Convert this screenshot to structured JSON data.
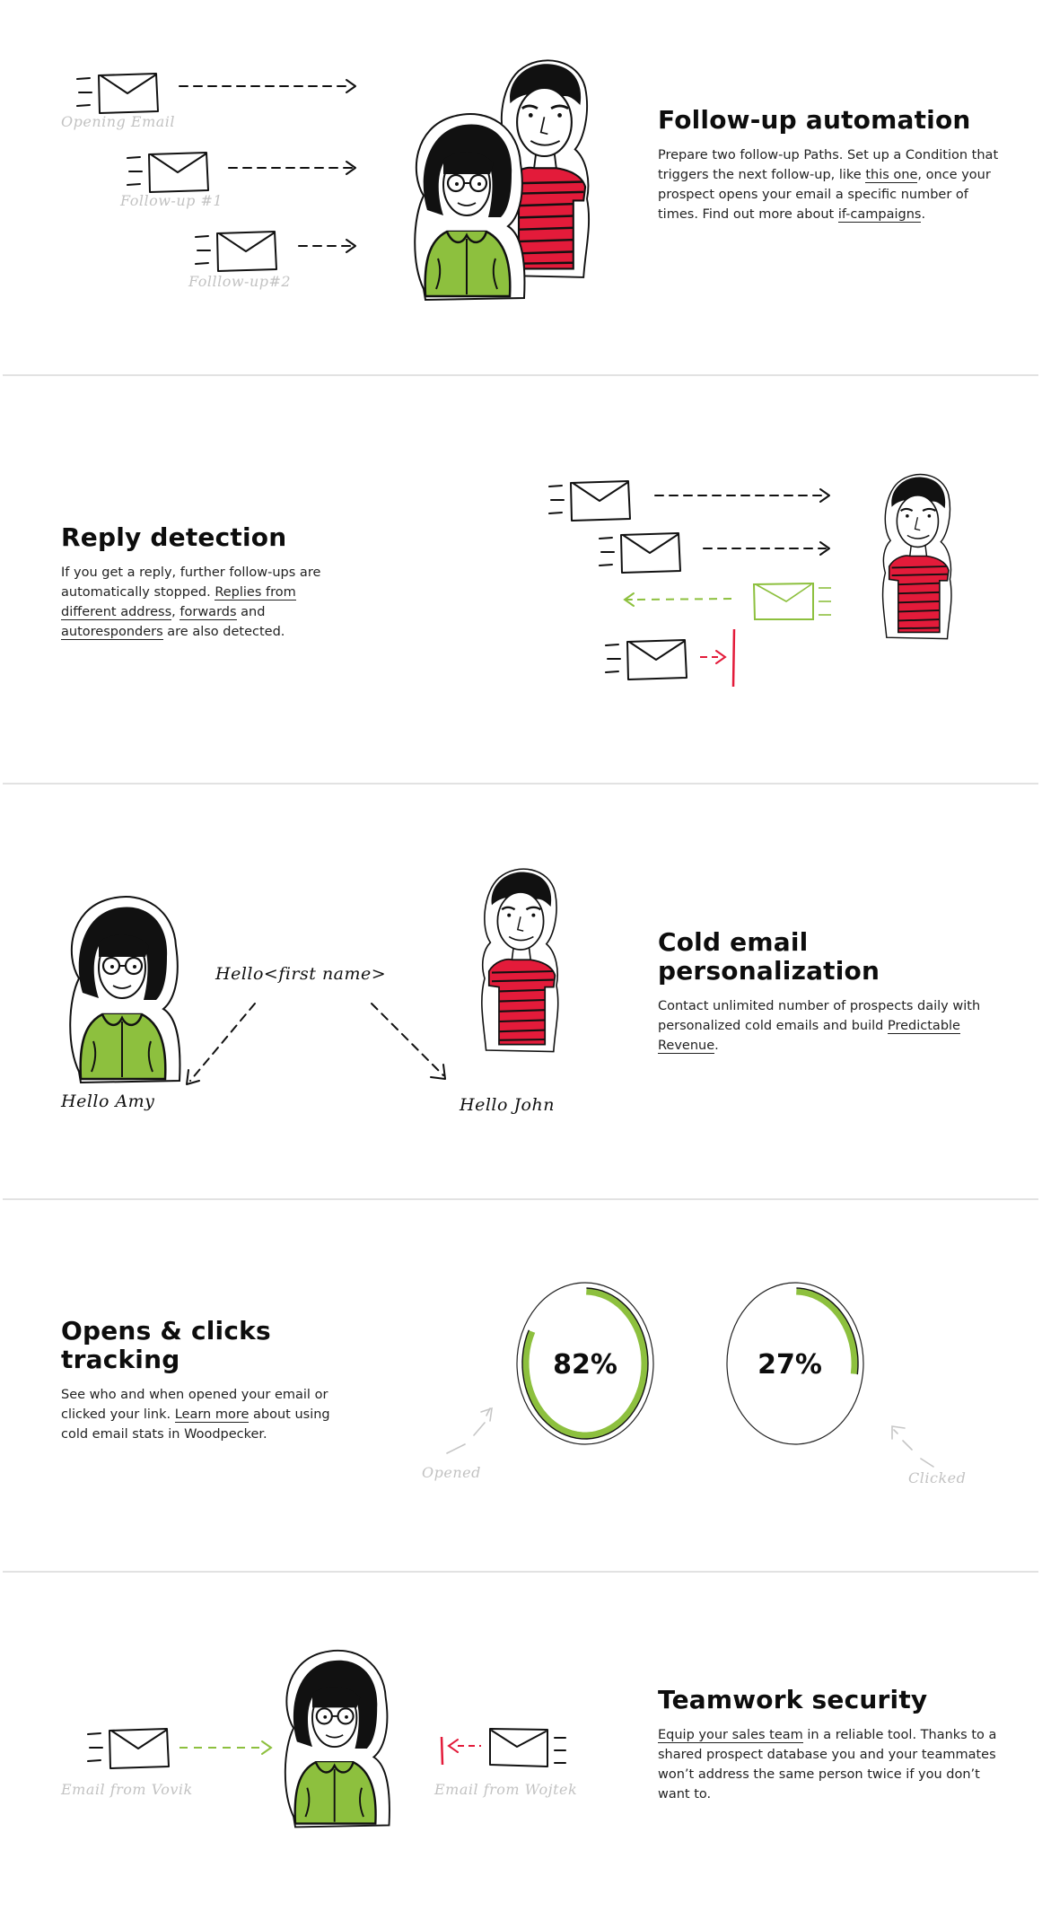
{
  "colors": {
    "green": "#8dc03e",
    "red": "#e31b3a",
    "ink": "#111111",
    "hand_gray": "#c2c2c2",
    "separator": "#e2e2e2"
  },
  "sections": [
    {
      "id": "follow-up-automation",
      "title": "Follow-up automation",
      "desc": {
        "p1": "Prepare two follow-up Paths. Set up a Condition that triggers the next follow-up, like ",
        "link1": "this one",
        "p2": ", once your prospect opens your email a specific number of times. Find out more about ",
        "link2": "if-campaigns",
        "p3": "."
      },
      "illustration": {
        "labels": [
          "Opening Email",
          "Follow-up #1",
          "Folllow-up#2"
        ],
        "icons": [
          "envelope-icon",
          "envelope-icon",
          "envelope-icon",
          "woman-avatar",
          "man-avatar"
        ]
      }
    },
    {
      "id": "reply-detection",
      "title": "Reply detection",
      "desc": {
        "p1": "If you get a reply, further follow-ups are automatically stopped. ",
        "link1": "Replies from different address",
        "p2": ", ",
        "link2": "forwards",
        "p3": " and ",
        "link3": "autoresponders",
        "p4": " are also detected."
      },
      "illustration": {
        "icons": [
          "envelope-icon",
          "envelope-icon",
          "reply-envelope-icon",
          "blocked-envelope-icon",
          "man-avatar"
        ]
      }
    },
    {
      "id": "cold-email-personalization",
      "title": "Cold email personalization",
      "title_lines": [
        "Cold email",
        "personalization"
      ],
      "desc": {
        "p1": "Contact unlimited number of prospects daily with personalized cold emails and build ",
        "link1": "Predictable Revenue",
        "p2": "."
      },
      "illustration": {
        "template": "Hello<first name>",
        "outputs": [
          "Hello Amy",
          "Hello John"
        ]
      }
    },
    {
      "id": "opens-clicks-tracking",
      "title": "Opens & clicks tracking",
      "title_lines": [
        "Opens & clicks",
        "tracking"
      ],
      "desc": {
        "p1": "See who and when opened your email or clicked your link. ",
        "link1": "Learn more",
        "p2": " about using cold email stats in Woodpecker."
      },
      "illustration": {
        "gauges": [
          {
            "label": "Opened",
            "value": 82,
            "display": "82%"
          },
          {
            "label": "Clicked",
            "value": 27,
            "display": "27%"
          }
        ]
      }
    },
    {
      "id": "teamwork-security",
      "title": "Teamwork security",
      "desc": {
        "link1": "Equip your sales team",
        "p1": " in a reliable tool. Thanks to a shared prospect database you and your teammates won’t address the same person twice if you don’t want to."
      },
      "illustration": {
        "labels": [
          "Email from Vovik",
          "Email from Wojtek"
        ]
      }
    }
  ]
}
